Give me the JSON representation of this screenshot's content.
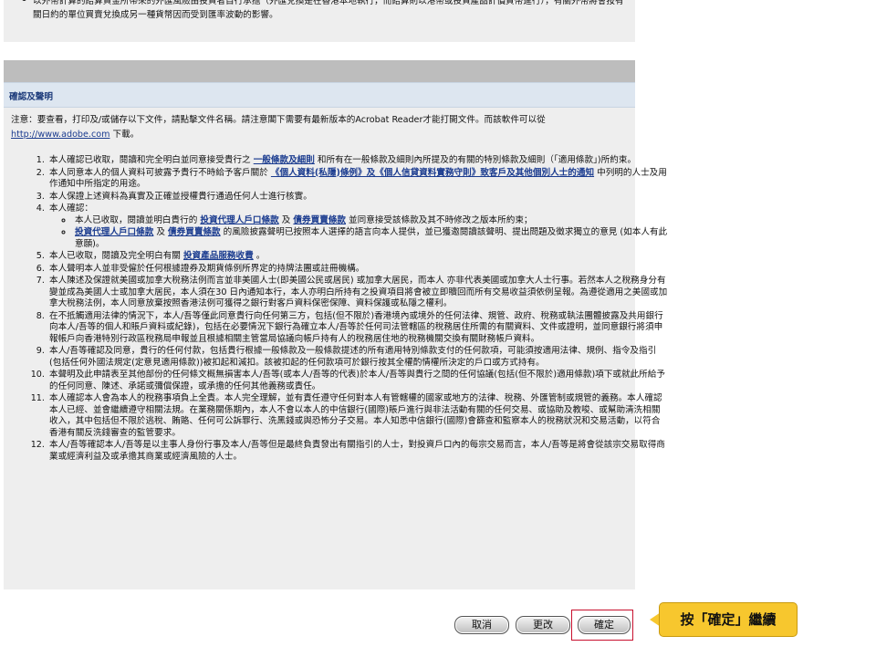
{
  "top_panel": {
    "text": "以外幣計算的結算資金所帶來的外匯風險由投資者自行承擔（外匯兌換是在香港本地執行，而結算則以港幣或投資產品計價貨幣進行），有關外幣將會按有關日約的單位買賣兌換成另一種貨幣因而受到匯率波動的影響。"
  },
  "section": {
    "title": "確認及聲明"
  },
  "note": {
    "text_before": "注意：要查看，打印及/或儲存以下文件，請點擊文件名稱。請注意閣下需要有最新版本的Acrobat Reader才能打開文件。而該軟件可以從",
    "url": "http://www.adobe.com",
    "text_after": " 下載。"
  },
  "terms": {
    "t1_a": "本人確認已收取，閱讀和完全明白並同意接受貴行之 ",
    "t1_link": "一般條款及細則",
    "t1_b": " 和所有在一般條款及細則內所提及的有關的特別條款及細則（「適用條款」)所約束。",
    "t2_a": "本人同意本人的個人資料可披露予貴行不時給予客戶關於 ",
    "t2_link": "《個人資料(私隱)條例》及《個人信貸資料實務守則》致客戶及其他個別人士的通知",
    "t2_b": " 中列明的人士及用作通知中所指定的用途。",
    "t3": "本人保證上述資料為真實及正確並授權貴行通過任何人士進行核實。",
    "t4": "本人確認：",
    "t4a_a": "本人已收取，閱讀並明白貴行的 ",
    "t4a_link1": "投資代理人戶口條款",
    "t4a_mid": " 及 ",
    "t4a_link2": "債券買賣條款",
    "t4a_b": " 並同意接受該條款及其不時修改之版本所約束；",
    "t4b_link1": "投資代理人戶口條款",
    "t4b_mid": " 及 ",
    "t4b_link2": "債券買賣條款",
    "t4b_b": " 的風險披露聲明已按照本人選擇的語言向本人提供，並已獲邀閱讀該聲明、提出問題及徵求獨立的意見 (如本人有此意願)。",
    "t5_a": "本人已收取，閱讀及完全明白有關 ",
    "t5_link": "投資產品服務收費",
    "t5_b": " 。",
    "t6": "本人聲明本人並非受僱於任何根據證券及期貨條例所界定的持牌法團或註冊機構。",
    "t7": "本人陳述及保證就美國或加拿大稅務法例而言並非美國人士(即美國公民或居民) 或加拿大居民，而本人 亦非代表美國或加拿大人士行事。若然本人之稅務身分有變並成為美國人士或加拿大居民，本人須在30 日內通知本行，本人亦明白所持有之投資項目將會被立即贖回而所有交易收益須依例呈報。為遵從適用之美國或加拿大稅務法例，本人同意放棄按照香港法例可獲得之銀行對客戶資料保密保障、資料保護或私隱之權利。",
    "t8": "在不抵觸適用法律的情況下，本人/吾等僅此同意貴行向任何第三方，包括(但不限於)香港境內或境外的任何法律、規管、政府、稅務或執法團體披露及共用銀行向本人/吾等的個人和賬戶資料或紀錄)，包括在必要情況下銀行為確立本人/吾等於任何司法管轄區的稅務居住所需的有關資料、文件或證明，並同意銀行將須申報帳戶向香港特別行政區稅務局申報並且根據相關主管當局協議向帳戶持有人的稅務居住地的稅務機關交換有關財務帳戶資料。",
    "t9": "本人/吾等確認及同意，貴行的任何付款，包括貴行根據一般條款及一般條款提述的所有適用特別條款支付的任何款項，可能須按適用法律、規例、指令及指引(包括任何外國法規定(定意見適用條款))被扣起和減扣。該被扣起的任何款項可於銀行按其全權酌情權所決定的戶口或方式持有。",
    "t10": "本聲明及此申請表至其他部份的任何條文概無損害本人/吾等(或本人/吾等的代表)於本人/吾等與貴行之間的任何協議(包括(但不限於)適用條款)項下或就此所給予的任何同意、陳述、承諾或彌償保證，或承擔的任何其他義務或責任。",
    "t11": "本人確認本人會為本人的稅務事項負上全責。本人完全理解，並有責任遵守任何對本人有管轄權的國家或地方的法律、稅務、外匯管制或規管的義務。本人確認本人已經、並會繼續遵守相關法規。在業務關係期內，本人不會以本人的中信銀行(國際)賬戶進行與非法活動有關的任何交易、或協助及教唆、或幫助清洗相關收入，其中包括但不限於逃稅、賄賂、任何可公訴罪行、洗黑錢或與恐怖分子交易。本人知悉中信銀行(國際)會篩查和監察本人的稅務狀況和交易活動，以符合香港有關反洗錢審查的監管要求。",
    "t12": "本人/吾等確認本人/吾等是以主事人身份行事及本人/吾等但是最終負責發出有關指引的人士，對投資戶口內的每宗交易而言，本人/吾等是將會從該宗交易取得商業或經濟利益及或承擔其商業或經濟風險的人士。"
  },
  "buttons": {
    "cancel": "取消",
    "modify": "更改",
    "confirm": "確定"
  },
  "callout": {
    "text": "按「確定」繼續"
  },
  "colors": {
    "link": "#1a3b8f",
    "panel_bg": "#eeeeee",
    "header_bg": "#dde6f0",
    "callout_bg": "#f7c72e",
    "highlight_border": "#c8102e"
  }
}
